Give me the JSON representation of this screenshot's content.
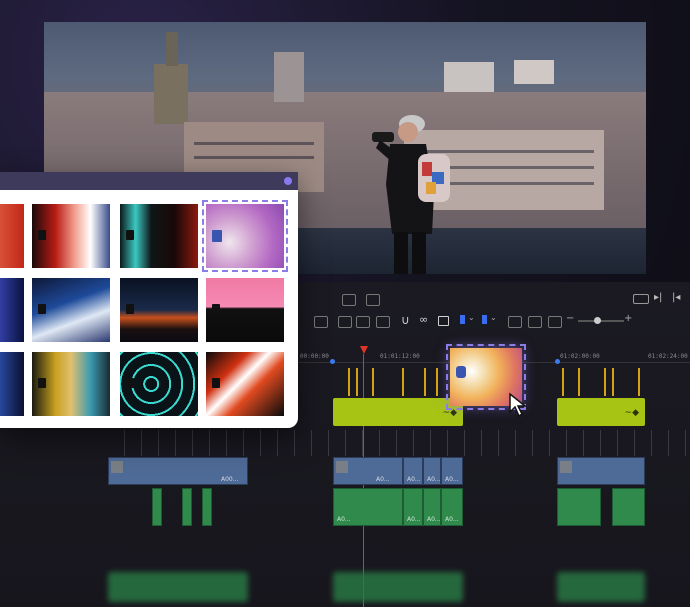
{
  "timeline": {
    "timecodes": [
      "00:00:00",
      "01:01:12:00",
      "01:02:00:00",
      "01:02:24:00"
    ],
    "video_clip_label": "A00...",
    "video_clip_short": "A0...",
    "audio_clip_short": "A0..."
  },
  "colors": {
    "accent": "#8b7de8",
    "green_clip": "#a7c415",
    "video_track": "#4e6a96",
    "audio_track": "#2f8a4c",
    "playhead": "#e0342a",
    "marker": "#d6a218"
  },
  "icons": [
    "play-icon",
    "next-icon",
    "fullscreen-icon",
    "razor-icon",
    "link-icon",
    "lock-icon",
    "flag-icon",
    "marker-icon",
    "zoom-icon"
  ]
}
